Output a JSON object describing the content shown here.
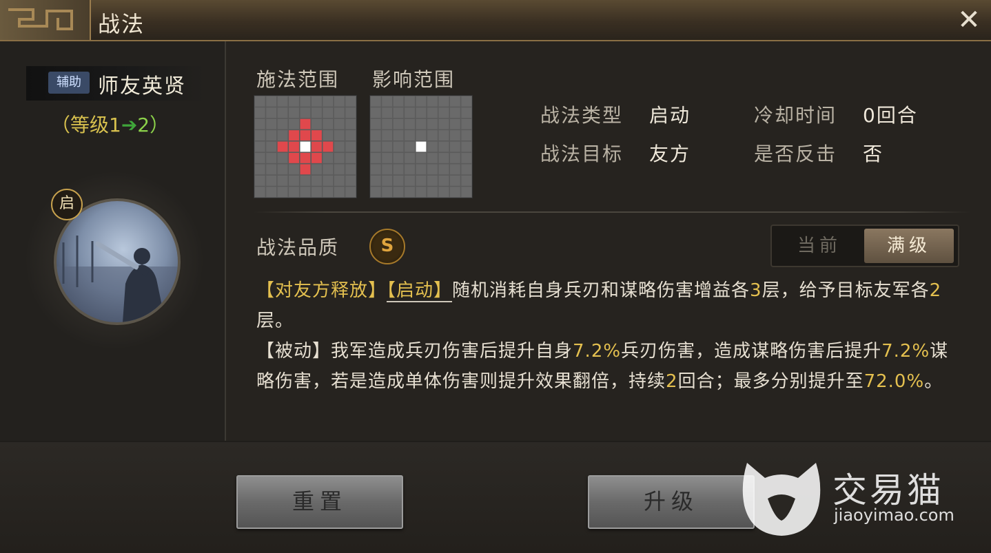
{
  "window": {
    "title": "战法",
    "close_icon": "close-icon"
  },
  "skill": {
    "role_tag": "辅助",
    "name": "师友英贤",
    "level_prefix": "（等级1",
    "level_arrow": "➔",
    "level_to": "2）",
    "type_badge": "启"
  },
  "ranges": {
    "cast_label": "施法范围",
    "effect_label": "影响范围"
  },
  "info": {
    "type_label": "战法类型",
    "type_value": "启动",
    "cooldown_label": "冷却时间",
    "cooldown_value": "0回合",
    "target_label": "战法目标",
    "target_value": "友方",
    "counter_label": "是否反击",
    "counter_value": "否"
  },
  "quality": {
    "label": "战法品质",
    "grade": "S"
  },
  "toggle": {
    "current": "当前",
    "full": "满级",
    "selected": "满级"
  },
  "description": {
    "p1": [
      {
        "t": "【对友方释放】",
        "c": "y"
      },
      {
        "t": "【启动】",
        "c": "yu"
      },
      {
        "t": "随机消耗自身兵刃和谋略伤害增益各",
        "c": ""
      },
      {
        "t": "3",
        "c": "y"
      },
      {
        "t": "层，给予目标友军各",
        "c": ""
      },
      {
        "t": "2",
        "c": "y"
      },
      {
        "t": "层。",
        "c": ""
      }
    ],
    "p2": [
      {
        "t": "【被动】我军造成兵刃伤害后提升自身",
        "c": ""
      },
      {
        "t": "7.2%",
        "c": "y"
      },
      {
        "t": "兵刃伤害，造成谋略伤害后提升",
        "c": ""
      },
      {
        "t": "7.2%",
        "c": "y"
      },
      {
        "t": "谋略伤害，若是造成单体伤害则提升效果翻倍，持续",
        "c": ""
      },
      {
        "t": "2",
        "c": "y"
      },
      {
        "t": "回合；最多分别提升至",
        "c": ""
      },
      {
        "t": "72.0%",
        "c": "y"
      },
      {
        "t": "。",
        "c": ""
      }
    ]
  },
  "buttons": {
    "reset": "重置",
    "upgrade": "升级"
  },
  "watermark": {
    "brand": "交易猫",
    "url": "jiaoyimao.com"
  },
  "colors": {
    "highlight": "#e4c04f",
    "range_cell": "#e0484c",
    "origin_cell": "#ffffff",
    "grid": "#5b5b5b"
  }
}
